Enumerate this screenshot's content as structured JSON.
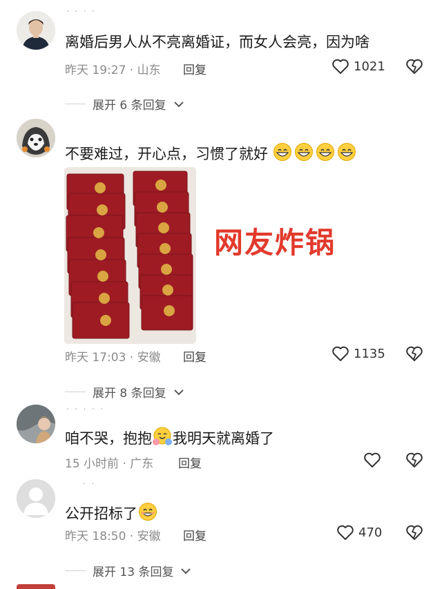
{
  "comments": [
    {
      "username_partial": "· · · ·",
      "text": "离婚后男人从不亮离婚证，而女人会亮，因为啥",
      "time_location": "昨天 19:27 · 山东",
      "reply_label": "回复",
      "likes": "1021",
      "expand_label": "展开 6 条回复"
    },
    {
      "text": "不要难过，开心点，习惯了就好",
      "image_overlay_text": "网友炸锅",
      "time_location": "昨天 17:03 · 安徽",
      "reply_label": "回复",
      "likes": "1135",
      "expand_label": "展开 8 条回复"
    },
    {
      "username_partial": "· · · · ·",
      "text_before": "咱不哭，抱抱",
      "text_after": "我明天就离婚了",
      "time_location": "15 小时前 · 广东",
      "reply_label": "回复",
      "likes": ""
    },
    {
      "username_partial": "· ·",
      "text": "公开招标了",
      "time_location": "昨天 18:50 · 安徽",
      "reply_label": "回复",
      "likes": "470",
      "expand_label": "展开 13 条回复"
    }
  ],
  "icons": {
    "like": "heart-outline-icon",
    "dislike": "broken-heart-icon",
    "expand": "chevron-down-icon",
    "emoji_grin": "grinning-emoji",
    "emoji_hug": "hugging-emoji",
    "emoji_smile": "smiling-emoji"
  },
  "colors": {
    "overlay_red": "#e23a2c",
    "meta_gray": "#8a8a8a",
    "certificate_red": "#9e1b24"
  }
}
